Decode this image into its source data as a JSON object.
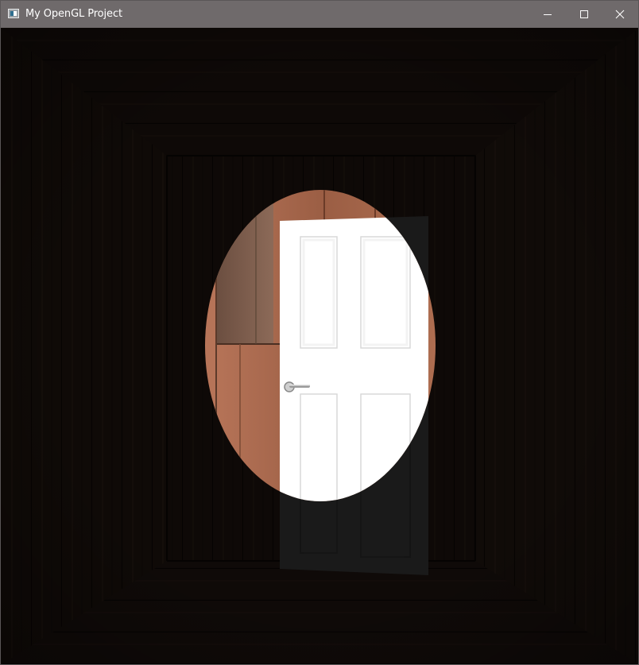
{
  "window": {
    "title": "My OpenGL Project",
    "icon": "app-icon",
    "controls": {
      "minimize_icon": "minimize-icon",
      "maximize_icon": "maximize-icon",
      "close_icon": "close-icon"
    }
  },
  "scene": {
    "description_icon": "3d-room-scene",
    "colors": {
      "wall_dark": "#120c09",
      "wood_lit": "#a8674c",
      "door_white": "#ffffff",
      "spotlight": "#ffffff"
    }
  }
}
